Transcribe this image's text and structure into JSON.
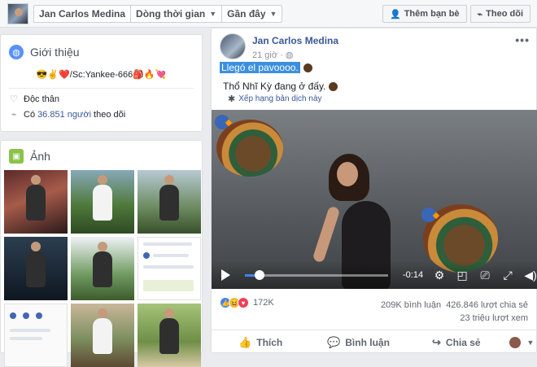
{
  "topbar": {
    "name": "Jan Carlos Medina",
    "timeline": "Dòng thời gian",
    "recent": "Gần đây",
    "add_friend": "Thêm bạn bè",
    "follow": "Theo dõi"
  },
  "intro": {
    "title": "Giới thiệu",
    "bio": "😎✌️❤️/Sc:Yankee-666🎒🔥💘",
    "status": "Độc thân",
    "followers_prefix": "Có",
    "followers_count": "36.851 người",
    "followers_suffix": "theo dõi"
  },
  "photos": {
    "title": "Ảnh"
  },
  "post": {
    "author": "Jan Carlos Medina",
    "time": "21 giờ",
    "text": "Llegó el pavoooo.",
    "translation": "Thổ Nhĩ Kỳ đang ở đấy.",
    "rate_translation": "Xếp hạng bản dịch này",
    "video_time": "-0:14",
    "video_progress": 0.1,
    "reactions_count": "172K",
    "comments": "209K bình luận",
    "shares": "426.846 lượt chia sẻ",
    "views": "23 triệu lượt xem",
    "like": "Thích",
    "comment": "Bình luận",
    "share": "Chia sẻ"
  }
}
